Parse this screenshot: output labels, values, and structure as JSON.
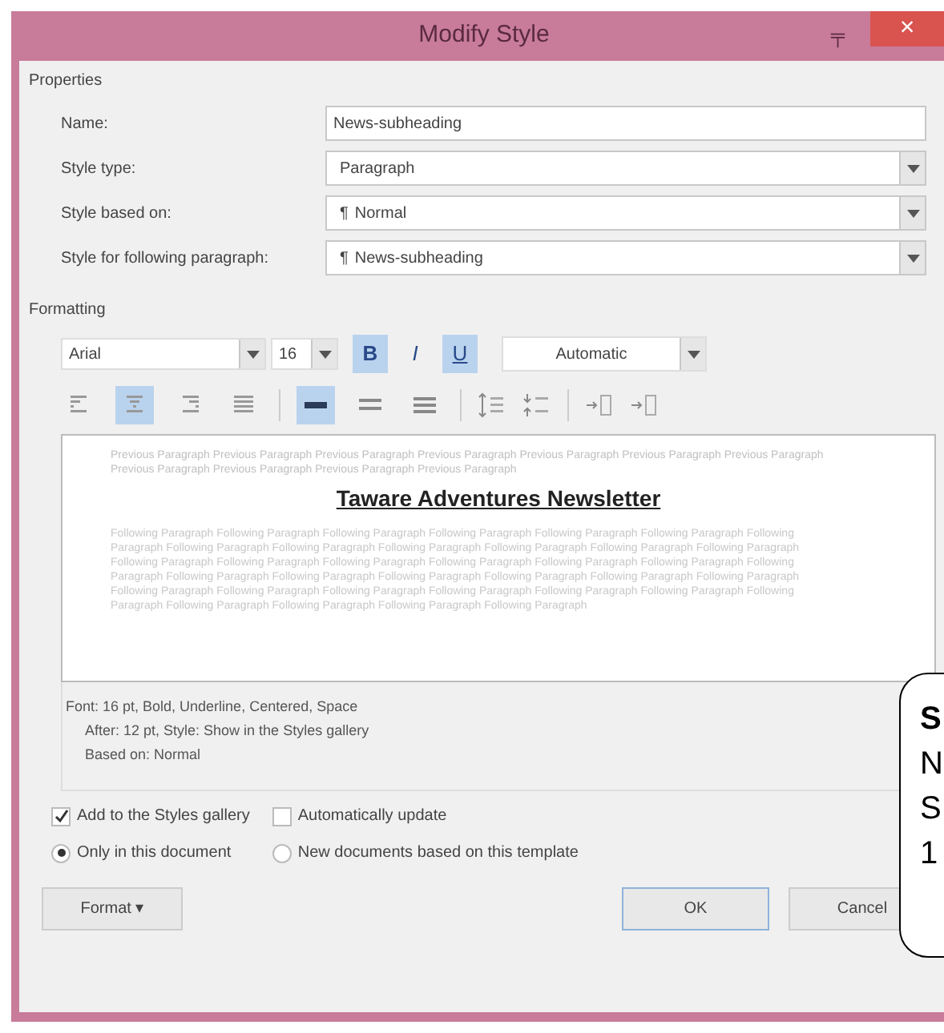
{
  "window": {
    "title": "Modify Style",
    "pin": "╤",
    "close": "×"
  },
  "properties": {
    "heading": "Properties",
    "fields": [
      {
        "label": "Name:",
        "value": "News-subheading",
        "kind": "text"
      },
      {
        "label": "Style type:",
        "value": "Paragraph",
        "kind": "dropdown"
      },
      {
        "label": "Style based on:",
        "value": "Normal",
        "kind": "dropdown",
        "para_mark": "¶"
      },
      {
        "label": "Style for following paragraph:",
        "value": "News-subheading",
        "kind": "dropdown",
        "para_mark": "¶"
      }
    ]
  },
  "formatting": {
    "heading": "Formatting",
    "font": "Arial",
    "size": "16",
    "color_setting": "Automatic",
    "styles": [
      {
        "label": "B",
        "selected": true,
        "kind": "bold"
      },
      {
        "label": "I",
        "selected": false,
        "kind": "italic"
      },
      {
        "label": "U",
        "selected": true,
        "kind": "underline"
      }
    ],
    "alignment": [
      {
        "selected": false
      },
      {
        "selected": true
      },
      {
        "selected": false
      },
      {
        "selected": false
      }
    ],
    "spacing": [
      {
        "selected": true
      },
      {
        "selected": false
      },
      {
        "selected": false
      }
    ]
  },
  "preview": {
    "previous": "Previous Paragraph Previous Paragraph Previous Paragraph Previous Paragraph Previous Paragraph Previous Paragraph Previous Paragraph Previous Paragraph Previous Paragraph Previous Paragraph Previous Paragraph",
    "sample": "Taware Adventures Newsletter",
    "following": "Following Paragraph Following Paragraph Following Paragraph Following Paragraph Following Paragraph Following Paragraph Following Paragraph Following Paragraph Following Paragraph Following Paragraph Following Paragraph Following Paragraph Following Paragraph Following Paragraph Following Paragraph Following Paragraph Following Paragraph Following Paragraph Following Paragraph Following Paragraph Following Paragraph Following Paragraph Following Paragraph Following Paragraph Following Paragraph Following Paragraph Following Paragraph Following Paragraph Following Paragraph Following Paragraph Following Paragraph Following Paragraph Following Paragraph Following Paragraph Following Paragraph Following Paragraph Following Paragraph"
  },
  "description": [
    "Font: 16 pt, Bold, Underline, Centered, Space",
    "After:  12 pt, Style: Show in the Styles gallery",
    "Based on: Normal"
  ],
  "options": [
    {
      "label": "Add to the Styles gallery",
      "checked": true,
      "kind": "checkbox"
    },
    {
      "label": "Automatically update",
      "checked": false,
      "kind": "checkbox"
    },
    {
      "label": "Only in this document",
      "selected": true,
      "kind": "radio"
    },
    {
      "label": "New documents based on this template",
      "selected": false,
      "kind": "radio"
    }
  ],
  "buttons": [
    {
      "label": "Format ▾",
      "kind": "format"
    },
    {
      "label": "OK",
      "kind": "ok"
    },
    {
      "label": "Cancel",
      "kind": "cancel"
    }
  ],
  "callout": {
    "lines": [
      "S",
      "N",
      "S",
      "1"
    ]
  }
}
